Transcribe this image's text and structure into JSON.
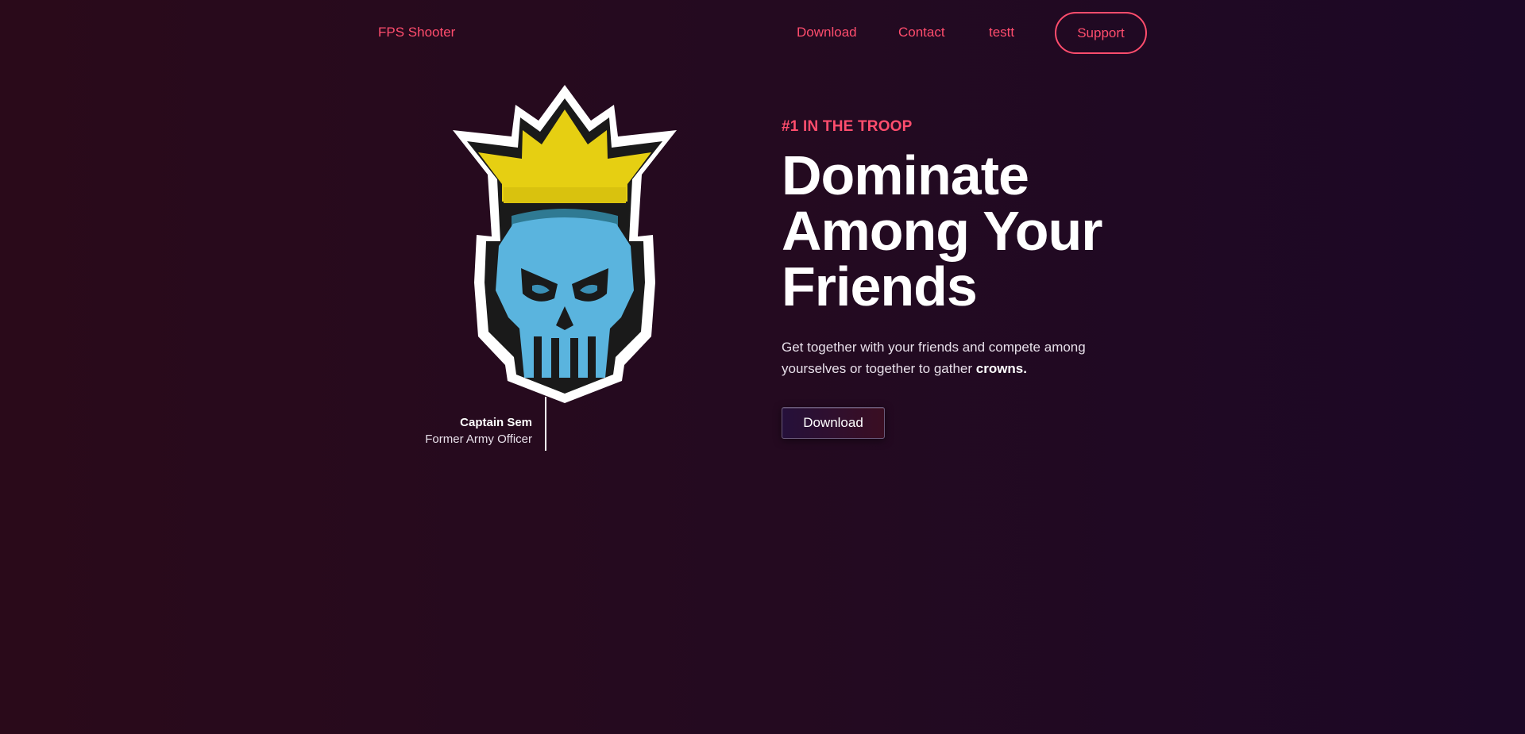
{
  "nav": {
    "brand": "FPS Shooter",
    "links": [
      "Download",
      "Contact",
      "testt"
    ],
    "support_label": "Support"
  },
  "hero": {
    "image_alt": "crowned-skull-logo",
    "caption_name": "Captain Sem",
    "caption_role": "Former Army Officer",
    "eyebrow": "#1 IN THE TROOP",
    "headline": [
      "Dominate",
      "Among Your",
      "Friends"
    ],
    "lede_text": "Get together with your friends and compete among yourselves or together to gather ",
    "lede_strong": "crowns.",
    "cta_label": "Download"
  },
  "colors": {
    "accent": "#ff4d6d",
    "crown": "#e6cf12",
    "skull": "#5ab4de"
  }
}
